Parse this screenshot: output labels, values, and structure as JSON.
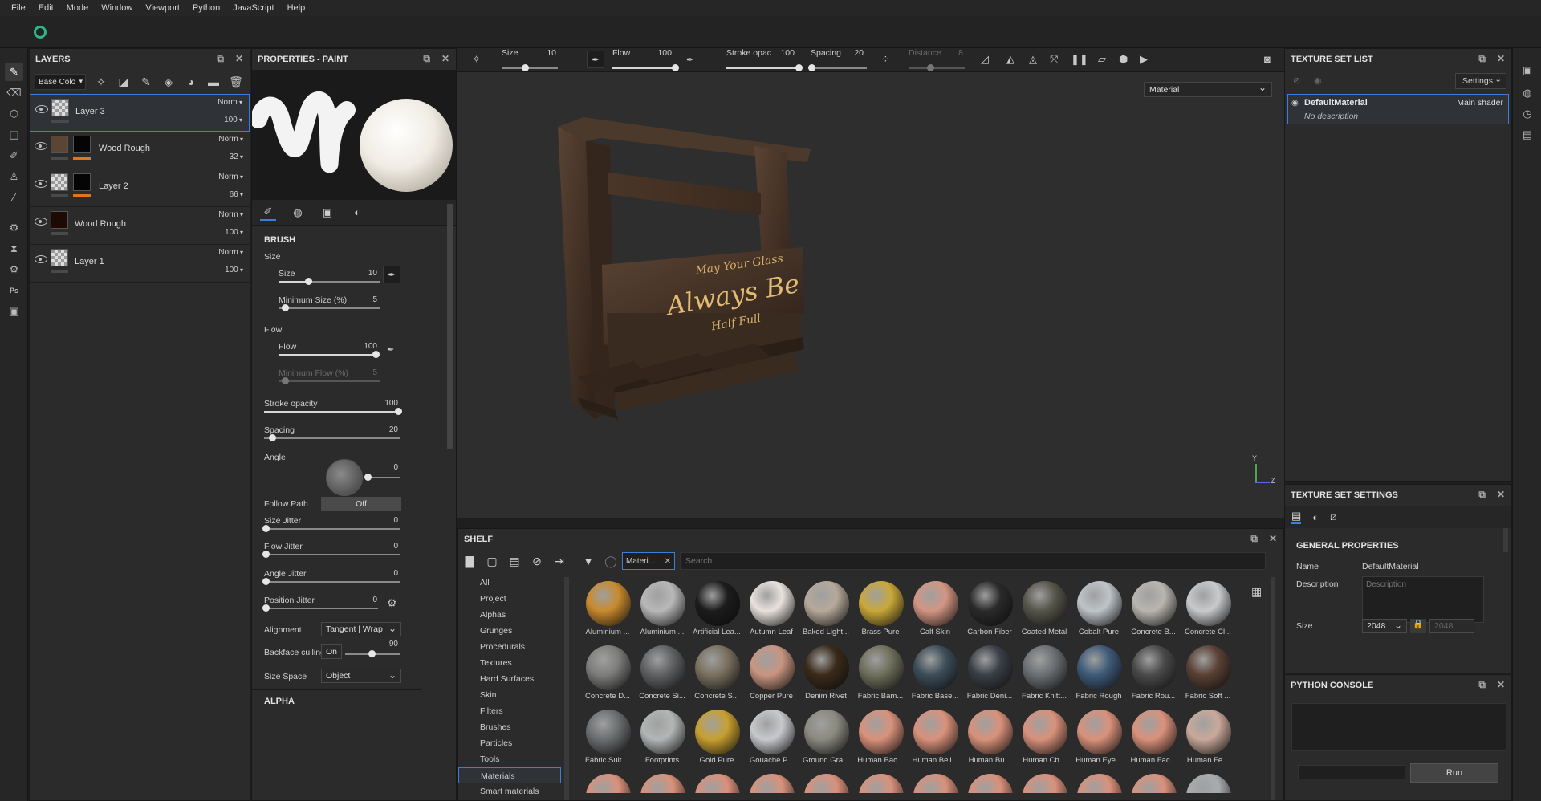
{
  "menu": [
    "File",
    "Edit",
    "Mode",
    "Window",
    "Viewport",
    "Python",
    "JavaScript",
    "Help"
  ],
  "layers_panel": {
    "title": "LAYERS",
    "channel": "Base Colo",
    "layers": [
      {
        "name": "Layer 3",
        "blend": "Norm",
        "opacity": "100"
      },
      {
        "name": "Wood Rough",
        "blend": "Norm",
        "opacity": "32"
      },
      {
        "name": "Layer 2",
        "blend": "Norm",
        "opacity": "66"
      },
      {
        "name": "Wood Rough",
        "blend": "Norm",
        "opacity": "100"
      },
      {
        "name": "Layer 1",
        "blend": "Norm",
        "opacity": "100"
      }
    ]
  },
  "properties": {
    "title": "PROPERTIES - PAINT",
    "brush_title": "BRUSH",
    "size_group": "Size",
    "size_label": "Size",
    "size_value": "10",
    "min_size_label": "Minimum Size (%)",
    "min_size_value": "5",
    "flow_group": "Flow",
    "flow_label": "Flow",
    "flow_value": "100",
    "min_flow_label": "Minimum Flow (%)",
    "min_flow_value": "5",
    "stroke_opacity_label": "Stroke opacity",
    "stroke_opacity_value": "100",
    "spacing_label": "Spacing",
    "spacing_value": "20",
    "angle_label": "Angle",
    "angle_value": "0",
    "follow_path_label": "Follow Path",
    "follow_path_value": "Off",
    "size_jitter_label": "Size Jitter",
    "size_jitter_value": "0",
    "flow_jitter_label": "Flow Jitter",
    "flow_jitter_value": "0",
    "angle_jitter_label": "Angle Jitter",
    "angle_jitter_value": "0",
    "position_jitter_label": "Position Jitter",
    "position_jitter_value": "0",
    "alignment_label": "Alignment",
    "alignment_value": "Tangent | Wrap",
    "backface_label": "Backface culling",
    "backface_toggle": "On",
    "backface_value": "90",
    "size_space_label": "Size Space",
    "size_space_value": "Object",
    "alpha_title": "ALPHA"
  },
  "viewport_toolbar": {
    "size_label": "Size",
    "size_value": "10",
    "flow_label": "Flow",
    "flow_value": "100",
    "stroke_label": "Stroke opac",
    "stroke_value": "100",
    "spacing_label": "Spacing",
    "spacing_value": "20",
    "distance_label": "Distance",
    "distance_value": "8"
  },
  "viewport": {
    "mode": "Material",
    "sign_line1": "May Your Glass",
    "sign_line2": "Always Be",
    "sign_line3": "Half Full",
    "axis_y": "Y",
    "axis_z": "Z"
  },
  "shelf": {
    "title": "SHELF",
    "filter_tag": "Materi...",
    "search_placeholder": "Search...",
    "categories": [
      "All",
      "Project",
      "Alphas",
      "Grunges",
      "Procedurals",
      "Textures",
      "Hard Surfaces",
      "Skin",
      "Filters",
      "Brushes",
      "Particles",
      "Tools",
      "Materials",
      "Smart materials"
    ],
    "active_category": "Materials",
    "materials": [
      {
        "name": "Aluminium ...",
        "color": "#c98a2e"
      },
      {
        "name": "Aluminium ...",
        "color": "#b8b8b8"
      },
      {
        "name": "Artificial Lea...",
        "color": "#1c1c1c"
      },
      {
        "name": "Autumn Leaf",
        "color": "#e8e2dc"
      },
      {
        "name": "Baked Light...",
        "color": "#b6a99a"
      },
      {
        "name": "Brass Pure",
        "color": "#c9a838"
      },
      {
        "name": "Calf Skin",
        "color": "#d39583"
      },
      {
        "name": "Carbon Fiber",
        "color": "#2a2a2a"
      },
      {
        "name": "Coated Metal",
        "color": "#56554a"
      },
      {
        "name": "Cobalt Pure",
        "color": "#bfc4c9"
      },
      {
        "name": "Concrete B...",
        "color": "#b9b6b1"
      },
      {
        "name": "Concrete Cl...",
        "color": "#c8cacc"
      },
      {
        "name": "Concrete D...",
        "color": "#7d7d7b"
      },
      {
        "name": "Concrete Si...",
        "color": "#5f6163"
      },
      {
        "name": "Concrete S...",
        "color": "#7a7060"
      },
      {
        "name": "Copper Pure",
        "color": "#c89580"
      },
      {
        "name": "Denim Rivet",
        "color": "#3a2a1a"
      },
      {
        "name": "Fabric Bam...",
        "color": "#6f6f5c"
      },
      {
        "name": "Fabric Base...",
        "color": "#3c4d5a"
      },
      {
        "name": "Fabric Deni...",
        "color": "#3a3f46"
      },
      {
        "name": "Fabric Knitt...",
        "color": "#6b6f72"
      },
      {
        "name": "Fabric Rough",
        "color": "#3e5a78"
      },
      {
        "name": "Fabric Rou...",
        "color": "#4a4a4a"
      },
      {
        "name": "Fabric Soft ...",
        "color": "#5a4034"
      },
      {
        "name": "Fabric Suit ...",
        "color": "#6b6e70"
      },
      {
        "name": "Footprints",
        "color": "#b3b6b6"
      },
      {
        "name": "Gold Pure",
        "color": "#c8a030"
      },
      {
        "name": "Gouache P...",
        "color": "#c8c9cc"
      },
      {
        "name": "Ground Gra...",
        "color": "#8a8a80"
      },
      {
        "name": "Human Bac...",
        "color": "#d9917b"
      },
      {
        "name": "Human Bell...",
        "color": "#d9917b"
      },
      {
        "name": "Human Bu...",
        "color": "#d9917b"
      },
      {
        "name": "Human Ch...",
        "color": "#d9917b"
      },
      {
        "name": "Human Eye...",
        "color": "#d9917b"
      },
      {
        "name": "Human Fac...",
        "color": "#d9917b"
      },
      {
        "name": "Human Fe...",
        "color": "#c9a99a"
      }
    ]
  },
  "texture_set_list": {
    "title": "TEXTURE SET LIST",
    "settings_label": "Settings",
    "item_name": "DefaultMaterial",
    "item_shader": "Main shader",
    "item_desc": "No description"
  },
  "texture_set_settings": {
    "title": "TEXTURE SET SETTINGS",
    "general_title": "GENERAL PROPERTIES",
    "name_label": "Name",
    "name_value": "DefaultMaterial",
    "desc_label": "Description",
    "desc_placeholder": "Description",
    "size_label": "Size",
    "size_value": "2048",
    "size_linked": "2048"
  },
  "python_console": {
    "title": "PYTHON CONSOLE",
    "run_label": "Run"
  },
  "colors": {
    "accent": "#3b7fd8",
    "orange": "#e0761b",
    "logo": "#2fb58a"
  }
}
